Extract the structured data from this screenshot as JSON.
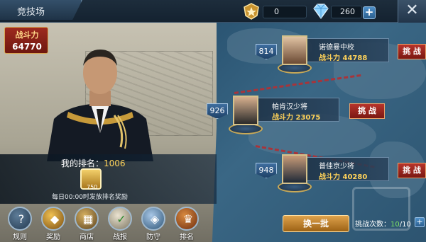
{
  "header": {
    "title": "竞技场",
    "rank_points": "0",
    "diamonds": "260",
    "add_label": "+",
    "close_label": "✕"
  },
  "player": {
    "power_label": "战斗力",
    "power_value": "64770",
    "rank_label": "我的排名：",
    "rank_value": "1006",
    "medal_count": "750",
    "reward_note": "每日00:00时发放排名奖励"
  },
  "opponents": [
    {
      "level": "814",
      "name": "诺德曼中校",
      "power": "战斗力 44788",
      "challenge": "挑 战"
    },
    {
      "level": "926",
      "name": "帕肯汉少将",
      "power": "战斗力 23075",
      "challenge": "挑 战"
    },
    {
      "level": "948",
      "name": "普佳京少将",
      "power": "战斗力 40280",
      "challenge": "挑 战"
    }
  ],
  "nav": [
    {
      "label": "规则",
      "icon": "question-icon",
      "glyph": "?"
    },
    {
      "label": "奖励",
      "icon": "treasure-icon",
      "glyph": "◆"
    },
    {
      "label": "商店",
      "icon": "shop-icon",
      "glyph": "▦"
    },
    {
      "label": "战报",
      "icon": "report-icon",
      "glyph": "✓"
    },
    {
      "label": "防守",
      "icon": "shield-icon",
      "glyph": "◈"
    },
    {
      "label": "排名",
      "icon": "trophy-icon",
      "glyph": "♛"
    }
  ],
  "refresh_label": "换一批",
  "attempts": {
    "label": "挑战次数：",
    "current": "10",
    "total": "/10"
  },
  "colors": {
    "accent_gold": "#ffd35a",
    "challenge_red": "#b8342b",
    "panel_blue": "#2a5472"
  }
}
